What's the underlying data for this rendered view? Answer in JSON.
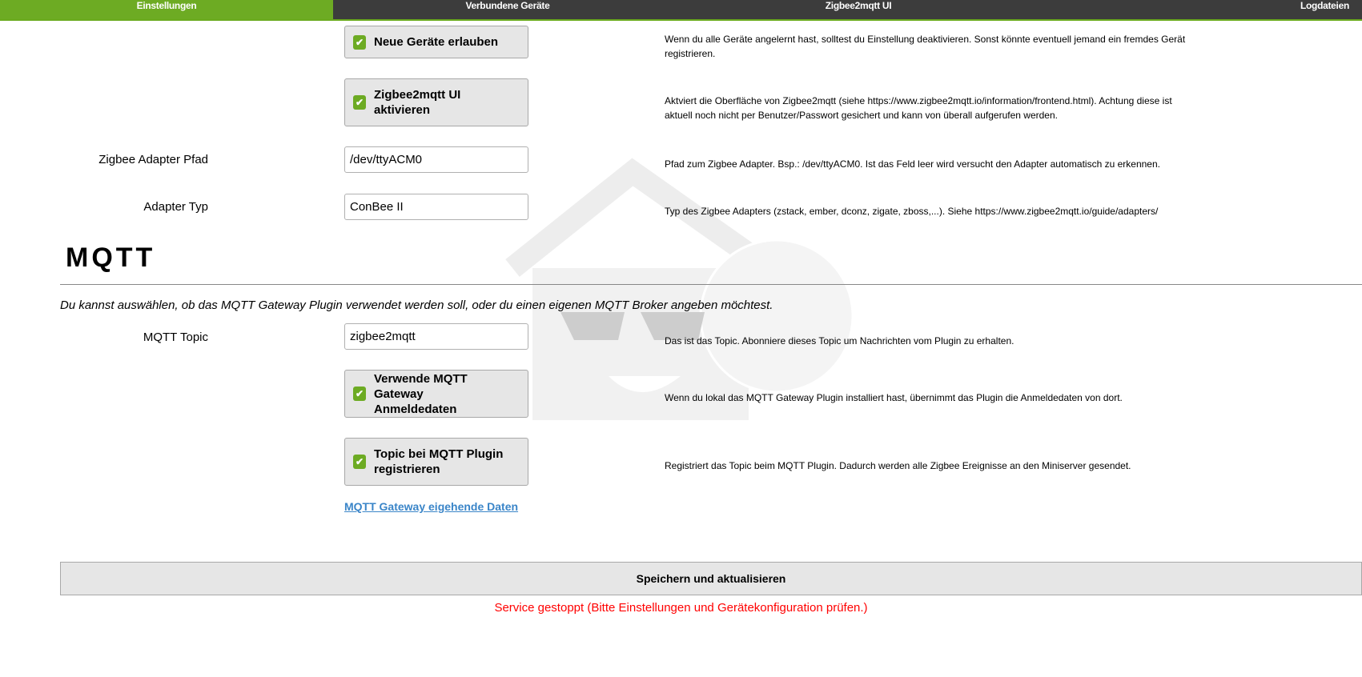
{
  "tabs": [
    "Einstellungen",
    "Verbundene Geräte",
    "Zigbee2mqtt UI",
    "Logdateien"
  ],
  "settings": {
    "new_devices": {
      "label": "Neue Geräte erlauben",
      "checked": true,
      "desc": "Wenn du alle Geräte angelernt hast, solltest du Einstellung deaktivieren. Sonst könnte eventuell jemand ein fremdes Gerät registrieren."
    },
    "ui": {
      "label": "Zigbee2mqtt UI aktivieren",
      "checked": true,
      "desc": "Aktviert die Oberfläche von Zigbee2mqtt (siehe https://www.zigbee2mqtt.io/information/frontend.html). Achtung diese ist aktuell noch nicht per Benutzer/Passwort gesichert und kann von überall aufgerufen werden."
    },
    "adapter_path": {
      "label": "Zigbee Adapter Pfad",
      "value": "/dev/ttyACM0",
      "desc": "Pfad zum Zigbee Adapter. Bsp.: /dev/ttyACM0. Ist das Feld leer wird versucht den Adapter automatisch zu erkennen."
    },
    "adapter_type": {
      "label": "Adapter Typ",
      "value": "ConBee II",
      "desc": "Typ des Zigbee Adapters (zstack, ember, dconz, zigate, zboss,...). Siehe https://www.zigbee2mqtt.io/guide/adapters/"
    }
  },
  "mqtt": {
    "heading": "MQTT",
    "intro": "Du kannst auswählen, ob das MQTT Gateway Plugin verwendet werden soll, oder du einen eigenen MQTT Broker angeben möchtest.",
    "topic": {
      "label": "MQTT Topic",
      "value": "zigbee2mqtt",
      "desc": "Das ist das Topic. Abonniere dieses Topic um Nachrichten vom Plugin zu erhalten."
    },
    "gateway_creds": {
      "label": "Verwende MQTT Gateway Anmeldedaten",
      "checked": true,
      "desc": "Wenn du lokal das MQTT Gateway Plugin installiert hast, übernimmt das Plugin die Anmeldedaten von dort."
    },
    "register_topic": {
      "label": "Topic bei MQTT Plugin registrieren",
      "checked": true,
      "desc": "Registriert das Topic beim MQTT Plugin. Dadurch werden alle Zigbee Ereignisse an den Miniserver gesendet."
    },
    "link": "MQTT Gateway eigehende Daten"
  },
  "save_label": "Speichern und aktualisieren",
  "status": "Service gestoppt (Bitte Einstellungen und Gerätekonfiguration prüfen.)",
  "check_glyph": "✔"
}
